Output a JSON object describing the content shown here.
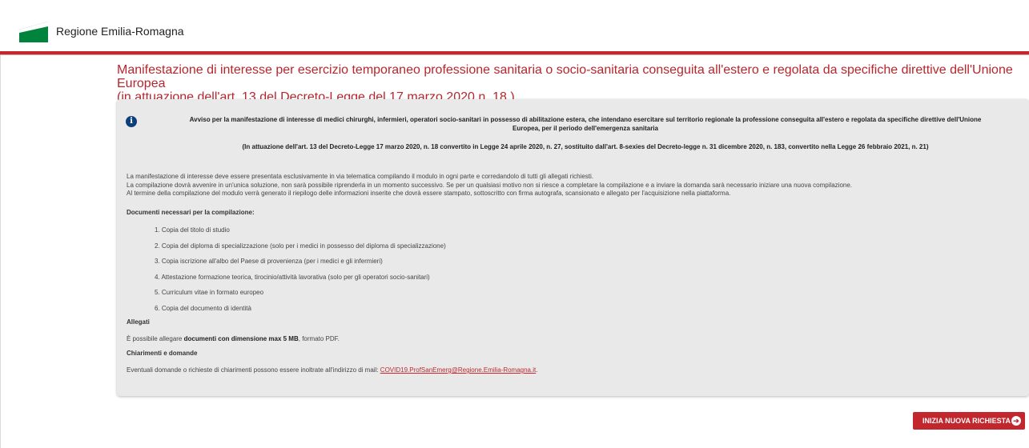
{
  "header": {
    "brand": "Regione Emilia-Romagna"
  },
  "page": {
    "title_line1": "Manifestazione di interesse per esercizio temporaneo professione sanitaria  o socio-sanitaria conseguita all'estero e regolata da specifiche direttive dell'Unione Europea",
    "title_line2": "(in attuazione dell'art. 13 del Decreto-Legge del 17 marzo 2020 n. 18.)"
  },
  "panel": {
    "notice_line1": "Avviso per la manifestazione di interesse di medici chirurghi, infermieri, operatori socio-sanitari in possesso di abilitazione estera, che intendano esercitare sul territorio regionale la professione conseguita all'estero e regolata da specifiche direttive dell'Unione",
    "notice_line2": "Europea, per il periodo dell'emergenza sanitaria",
    "notice_sub": "(In attuazione dell'art. 13 del Decreto-Legge 17 marzo 2020, n. 18 convertito in Legge 24 aprile 2020, n. 27, sostituito dall'art. 8-sexies del Decreto-legge n. 31 dicembre 2020, n. 183, convertito nella Legge 26 febbraio 2021, n. 21)",
    "paragraphs": [
      "La manifestazione di interesse deve essere presentata esclusivamente in via telematica compilando il modulo in ogni parte e corredandolo di tutti gli allegati richiesti.",
      "La compilazione dovrà avvenire in un'unica soluzione, non sarà possibile riprenderla in un momento successivo. Se per un qualsiasi motivo non si riesce a completare la compilazione e a inviare la domanda sarà necessario iniziare una nuova compilazione.",
      "Al termine della compilazione del modulo verrà generato il riepilogo delle informazioni inserite che dovrà essere stampato, sottoscritto con firma autografa, scansionato e allegato per l'acquisizione nella piattaforma."
    ],
    "docs_heading": "Documenti necessari per la compilazione:",
    "docs": [
      "1. Copia del titolo di studio",
      "2. Copia del diploma di specializzazione (solo per i medici in possesso del diploma di specializzazione)",
      "3. Copia iscrizione all'albo del Paese di provenienza (per i medici e gli infermieri)",
      "4. Attestazione formazione teorica, tirocinio/attività lavorativa (solo per gli operatori socio-sanitari)",
      "5. Curriculum vitae in formato europeo",
      "6. Copia del documento di identità"
    ],
    "allegati_heading": "Allegati",
    "allegati_pre": "È possibile allegare ",
    "allegati_bold": "documenti con dimensione max 5 MB",
    "allegati_post": ", formato PDF.",
    "chiar_heading": "Chiarimenti e domande",
    "chiar_text": "Eventuali domande o richieste di chiarimenti possono essere inoltrate all'indirizzo di mail: ",
    "chiar_email": "COVID19.ProfSanEmerg@Regione.Emilia-Romagna.it",
    "chiar_post": "."
  },
  "actions": {
    "new_request_label": "INIZIA NUOVA RICHIESTA",
    "icon": "arrow-right-circle-icon"
  },
  "colors": {
    "accent": "#c1272d",
    "panel_bg": "#e9e9e9",
    "logo_green": "#00843d"
  }
}
